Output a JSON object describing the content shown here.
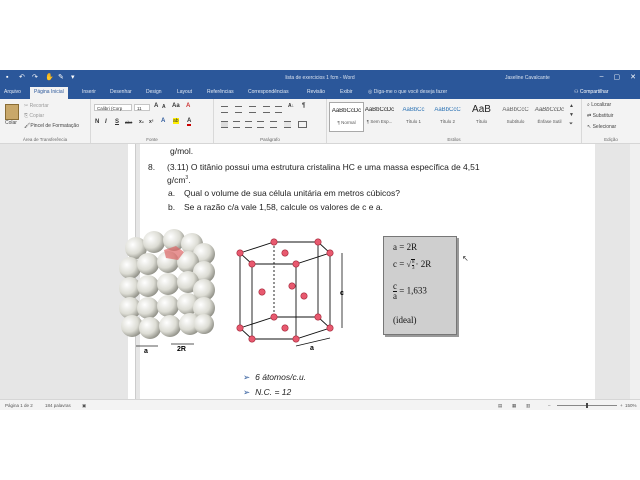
{
  "window": {
    "title": "lista de exercicios 1 fcm  -  Word",
    "user": "Jaseline Cavalcante",
    "controls": [
      "–",
      "▢",
      "✕"
    ]
  },
  "tabs": [
    "Arquivo",
    "Página Inicial",
    "Inserir",
    "Desenhar",
    "Design",
    "Layout",
    "Referências",
    "Correspondências",
    "Revisão",
    "Exibir"
  ],
  "tell_me": "Diga-me o que você deseja fazer",
  "share": "Compartilhar",
  "ribbon": {
    "clipboard": {
      "paste": "Colar",
      "cut": "Recortar",
      "copy": "Copiar",
      "format_painter": "Pincel de Formatação",
      "group": "Área de Transferência"
    },
    "font": {
      "name": "Calibri (Corp",
      "size": "11",
      "group": "Fonte",
      "bold": "N",
      "italic": "I",
      "underline": "S",
      "strike": "abc"
    },
    "paragraph": {
      "group": "Parágrafo"
    },
    "styles": {
      "group": "Estilos",
      "items": [
        {
          "preview": "AaBbCcDc",
          "name": "¶ Normal",
          "color": "#222222"
        },
        {
          "preview": "AaBbCcDc",
          "name": "¶ Sem Esp...",
          "color": "#222222"
        },
        {
          "preview": "AaBbCc",
          "name": "Título 1",
          "color": "#2e74b5"
        },
        {
          "preview": "AaBbCcC",
          "name": "Título 2",
          "color": "#2e74b5"
        },
        {
          "preview": "AaB",
          "name": "Título",
          "color": "#222222"
        },
        {
          "preview": "AaBbCcC",
          "name": "Subtítulo",
          "color": "#666666"
        },
        {
          "preview": "AaBbCcDc",
          "name": "Ênfase Sutil",
          "color": "#555555"
        }
      ]
    },
    "editing": {
      "find": "Localizar",
      "replace": "Substituir",
      "select": "Selecionar",
      "group": "Edição"
    }
  },
  "document": {
    "line_top": "g/mol.",
    "q_number": "8.",
    "q_text": "(3.11) O titânio possui uma estrutura cristalina HC e uma massa específica de 4,51",
    "q_unit": "g/cm",
    "q_unit_sup": "3",
    "q_unit_end": ".",
    "item_a_label": "a.",
    "item_a": "Qual o volume de sua célula unitária em metros cúbicos?",
    "item_b_label": "b.",
    "item_b": "Se a razão c/a vale 1,58, calcule os valores de c e a.",
    "figure_labels": {
      "a1": "a",
      "r2": "2R",
      "c": "c",
      "a2": "a"
    },
    "formula": {
      "line1": "a = 2R",
      "line2_pre": "c = ",
      "frac8": "8",
      "frac3": "3",
      "line2_post": "· 2R",
      "frac_c": "c",
      "frac_a": "a",
      "ratio": "= 1,633",
      "ideal": "(ideal)"
    },
    "bullets": [
      "6 átomos/c.u.",
      "N.C. = 12"
    ]
  },
  "status": {
    "page": "Página 1 de 2",
    "words": "184 palavras",
    "zoom": "150%",
    "zoom_fraction": 0.5
  }
}
